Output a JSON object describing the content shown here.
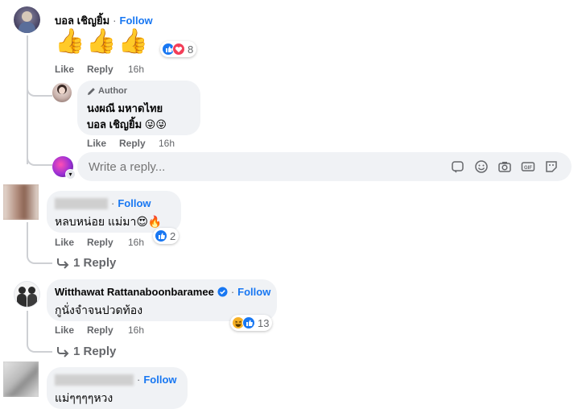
{
  "comments": [
    {
      "author": "บอล เชิญยิ้ม",
      "follow_label": "Follow",
      "emoji_text": "👍👍👍",
      "reaction_count": "8",
      "actions": {
        "like": "Like",
        "reply": "Reply",
        "time": "16h"
      },
      "reply": {
        "badge": "Author",
        "line1": "นงผณี มหาดไทย",
        "line2": "บอล เชิญยิ้ม 😜😜",
        "actions": {
          "like": "Like",
          "reply": "Reply",
          "time": "16h"
        }
      },
      "reply_input_placeholder": "Write a reply..."
    },
    {
      "author": "",
      "follow_label": "Follow",
      "text": "หลบหน่อย แม่มา😍🔥",
      "reaction_count": "2",
      "actions": {
        "like": "Like",
        "reply": "Reply",
        "time": "16h"
      },
      "replies_label": "1 Reply"
    },
    {
      "author": "Witthawat Rattanaboonbaramee",
      "follow_label": "Follow",
      "text": "กูนั่งจำจนปวดท้อง",
      "reaction_count": "13",
      "actions": {
        "like": "Like",
        "reply": "Reply",
        "time": "16h"
      },
      "replies_label": "1 Reply"
    },
    {
      "author": "",
      "follow_label": "Follow",
      "text": "แม่ๆๆๆๆหวง"
    }
  ],
  "colors": {
    "accent": "#1877f2",
    "bubble": "#f0f2f5",
    "muted": "#65676b",
    "like_blue": "#1877f2",
    "love_red": "#f33e58",
    "haha_yellow": "#f7b125"
  },
  "icons": [
    "pen-icon",
    "sticker-icon",
    "emoji-icon",
    "camera-icon",
    "gif-icon",
    "avatar-sticker-icon",
    "verified-icon",
    "reply-arrow-icon",
    "like-reaction-icon",
    "love-reaction-icon",
    "haha-reaction-icon"
  ]
}
